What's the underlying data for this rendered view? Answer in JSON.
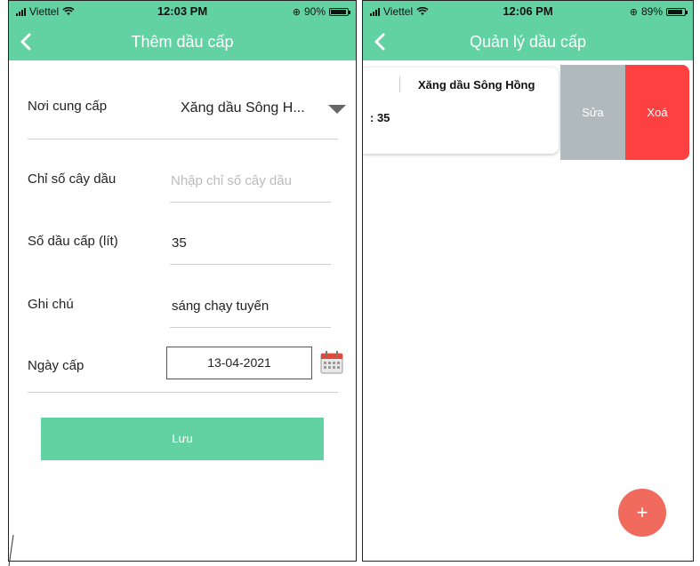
{
  "left": {
    "status": {
      "carrier": "Viettel",
      "time": "12:03 PM",
      "battery": "90%"
    },
    "title": "Thêm dầu cấp",
    "fields": {
      "provider": {
        "label": "Nơi cung cấp",
        "value": "Xăng dầu Sông H..."
      },
      "pump_index": {
        "label": "Chỉ số cây dầu",
        "placeholder": "Nhập chỉ số cây dầu"
      },
      "liters": {
        "label": "Số dầu cấp (lít)",
        "value": "35"
      },
      "note": {
        "label": "Ghi chú",
        "value": "sáng chạy tuyến"
      },
      "date": {
        "label": "Ngày cấp",
        "value": "13-04-2021"
      }
    },
    "save_label": "Lưu"
  },
  "right": {
    "status": {
      "carrier": "Viettel",
      "time": "12:06 PM",
      "battery": "89%"
    },
    "title": "Quản lý dầu cấp",
    "item": {
      "provider": "Xăng dầu Sông Hồng",
      "amount": ": 35"
    },
    "edit_label": "Sửa",
    "delete_label": "Xoá",
    "fab_label": "+"
  },
  "colors": {
    "accent": "#62d2a2",
    "danger": "#ff4040",
    "muted": "#b0b9bb",
    "fab": "#f06a5e"
  }
}
